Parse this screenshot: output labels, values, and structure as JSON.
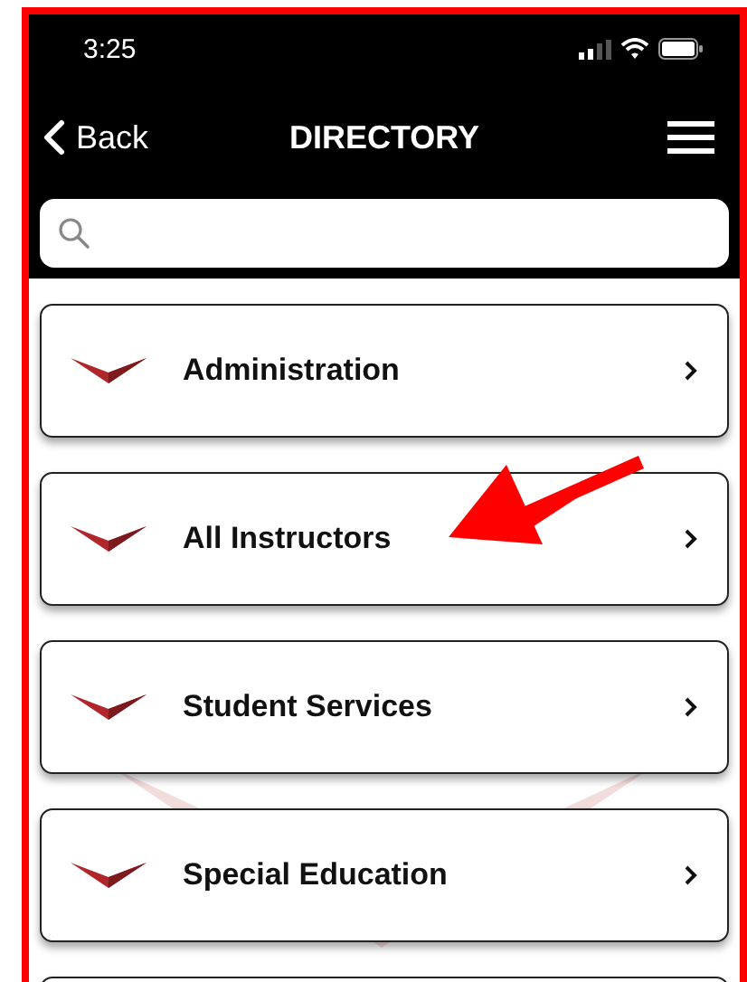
{
  "status_bar": {
    "time": "3:25"
  },
  "nav_bar": {
    "back": "Back",
    "title": "DIRECTORY"
  },
  "items": [
    {
      "label": "Administration"
    },
    {
      "label": "All Instructors"
    },
    {
      "label": "Student Services"
    },
    {
      "label": "Special Education"
    }
  ]
}
